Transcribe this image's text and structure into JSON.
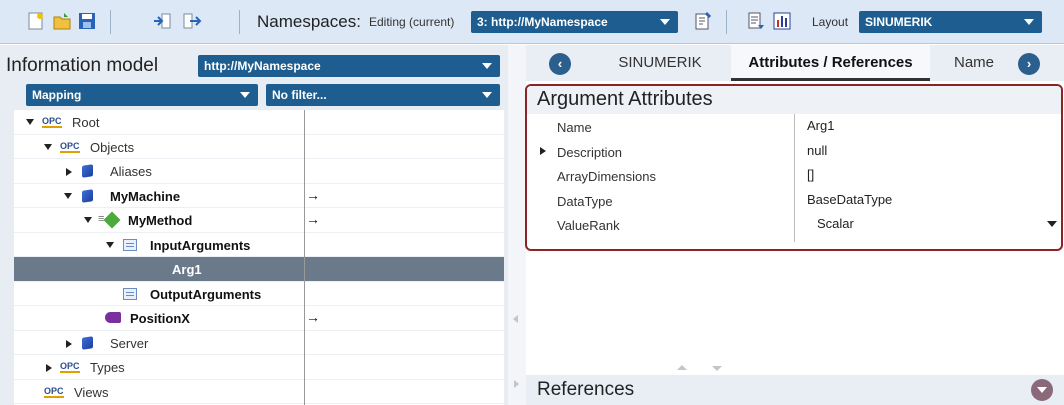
{
  "toolbar": {
    "namespaces_label": "Namespaces:",
    "editing_label": "Editing (current)",
    "namespace_value": "3: http://MyNamespace",
    "layout_label": "Layout",
    "layout_value": "SINUMERIK",
    "icons": [
      "new-file-icon",
      "open-folder-icon",
      "save-icon",
      "import-icon",
      "export-icon",
      "edit-namespace-icon",
      "properties-icon",
      "chart-icon"
    ]
  },
  "information_model": {
    "title": "Information model",
    "namespace_value": "http://MyNamespace",
    "mapping_value": "Mapping",
    "filter_value": "No filter..."
  },
  "tree": {
    "root": "Root",
    "objects": "Objects",
    "aliases": "Aliases",
    "mymachine": "MyMachine",
    "mymethod": "MyMethod",
    "inputarguments": "InputArguments",
    "arg1": "Arg1",
    "outputarguments": "OutputArguments",
    "positionx": "PositionX",
    "server": "Server",
    "types": "Types",
    "views": "Views",
    "opc_tag": "OPC",
    "arrow": "→"
  },
  "tabs": {
    "prev": "‹",
    "next": "›",
    "items": [
      "SINUMERIK",
      "Attributes / References",
      "Name"
    ]
  },
  "attributes": {
    "title": "Argument Attributes",
    "rows": [
      {
        "key": "Name",
        "value": "Arg1"
      },
      {
        "key": "Description",
        "value": "null"
      },
      {
        "key": "ArrayDimensions",
        "value": "[]"
      },
      {
        "key": "DataType",
        "value": "BaseDataType"
      },
      {
        "key": "ValueRank",
        "value": "Scalar"
      }
    ]
  },
  "references": {
    "title": "References"
  },
  "colors": {
    "accent": "#1d5d8f",
    "highlight_border": "#8b2424",
    "selected_row": "#6b7a8a"
  }
}
